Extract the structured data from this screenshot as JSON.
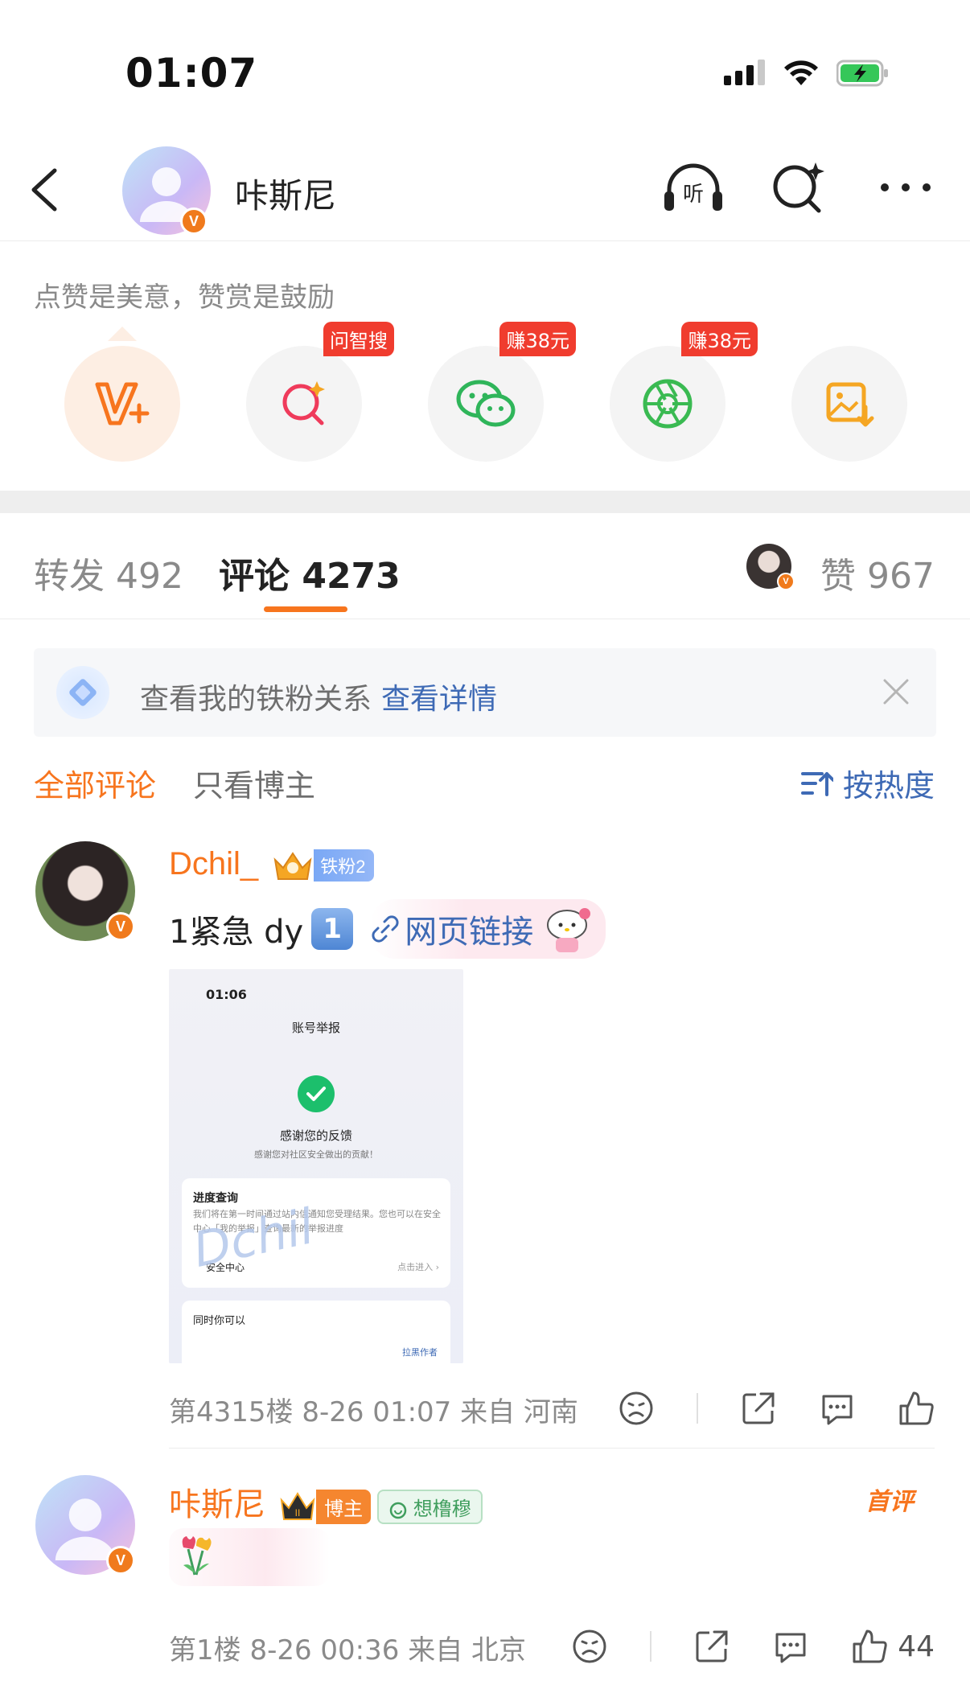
{
  "status_bar": {
    "time": "01:07"
  },
  "header": {
    "name": "咔斯尼"
  },
  "reward": {
    "tip": "点赞是美意，赞赏是鼓励",
    "items": [
      {
        "name": "v-plus",
        "tag": ""
      },
      {
        "name": "search",
        "tag": "问智搜"
      },
      {
        "name": "wechat",
        "tag": "赚38元"
      },
      {
        "name": "moments",
        "tag": "赚38元"
      },
      {
        "name": "save-image",
        "tag": ""
      }
    ]
  },
  "tabs": {
    "forward_label": "转发",
    "forward_count": "492",
    "comments_label": "评论",
    "comments_count": "4273",
    "likes_label": "赞",
    "likes_count": "967"
  },
  "fan_banner": {
    "text": "查看我的铁粉关系",
    "link": "查看详情"
  },
  "filters": {
    "all": "全部评论",
    "blogger_only": "只看博主",
    "sort": "按热度"
  },
  "comments": [
    {
      "user": "Dchil_",
      "fan_badge": "铁粉2",
      "text_prefix": "1紧急 dy",
      "num_emoji": "1",
      "link_text": "网页链接",
      "screenshot": {
        "time": "01:06",
        "title": "账号举报",
        "thanks": "感谢您的反馈",
        "sub": "感谢您对社区安全做出的贡献！",
        "progress_title": "进度查询",
        "progress_text": "我们将在第一时间通过站内信通知您受理结果。您也可以在安全中心「我的举报」查询最新的举报进度",
        "security_center": "安全中心",
        "enter": "点击进入 ›",
        "also": "同时你可以",
        "block": "拉黑作者",
        "signature": "Dchil"
      },
      "meta": "第4315楼 8-26 01:07 来自 河南"
    },
    {
      "user": "咔斯尼",
      "blogger_badge": "博主",
      "topic_badge": "想橹穆",
      "first_tag": "首评",
      "meta": "第1楼 8-26 00:36 来自 北京",
      "like_count": "44"
    }
  ],
  "colors": {
    "accent": "#f7751e",
    "link": "#3e6ab5",
    "muted": "#8a8a8a"
  }
}
